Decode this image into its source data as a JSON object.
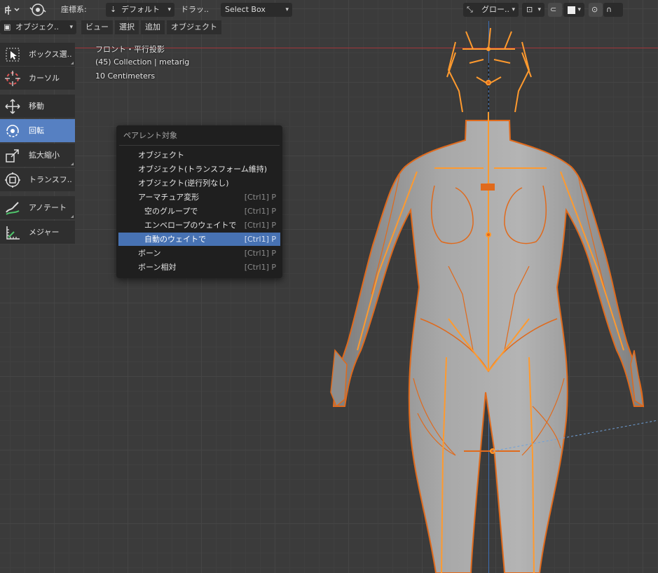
{
  "header": {
    "coord_label": "座標系:",
    "orientation_value": "デフォルト",
    "drag_label": "ドラッ..",
    "select_box": "Select Box",
    "transform_orient": "グロー..",
    "icons": [
      "transform-gizmo-icon",
      "pivot-icon",
      "orientation-axes-icon",
      "snap-icon",
      "proportional-icon",
      "falloff-icon",
      "overlay-icon",
      "shading-icon"
    ]
  },
  "row2": {
    "mode": "オブジェク..",
    "menus": [
      "ビュー",
      "選択",
      "追加",
      "オブジェクト"
    ]
  },
  "toolbar": {
    "items": [
      {
        "label": "ボックス選..",
        "icon": "select-box-icon",
        "active": false
      },
      {
        "label": "カーソル",
        "icon": "cursor-icon",
        "active": false
      },
      {
        "label": "移動",
        "icon": "move-icon",
        "active": false
      },
      {
        "label": "回転",
        "icon": "rotate-icon",
        "active": true
      },
      {
        "label": "拡大縮小",
        "icon": "scale-icon",
        "active": false
      },
      {
        "label": "トランスフ..",
        "icon": "transform-icon",
        "active": false
      },
      {
        "label": "アノテート",
        "icon": "annotate-icon",
        "active": false
      },
      {
        "label": "メジャー",
        "icon": "measure-icon",
        "active": false
      }
    ]
  },
  "overlay": {
    "view_name": "フロント・平行投影",
    "collection": "(45) Collection | metarig",
    "scale": "10 Centimeters"
  },
  "popup": {
    "title": "ペアレント対象",
    "items": [
      {
        "label": "オブジェクト",
        "shortcut": "",
        "sub": false,
        "selected": false
      },
      {
        "label": "オブジェクト(トランスフォーム維持)",
        "shortcut": "",
        "sub": false,
        "selected": false
      },
      {
        "label": "オブジェクト(逆行列なし)",
        "shortcut": "",
        "sub": false,
        "selected": false
      },
      {
        "label": "アーマチュア変形",
        "shortcut": "[Ctrl1] P",
        "sub": false,
        "selected": false
      },
      {
        "label": "空のグループで",
        "shortcut": "[Ctrl1] P",
        "sub": true,
        "selected": false
      },
      {
        "label": "エンベロープのウェイトで",
        "shortcut": "[Ctrl1] P",
        "sub": true,
        "selected": false
      },
      {
        "label": "自動のウェイトで",
        "shortcut": "[Ctrl1] P",
        "sub": true,
        "selected": true
      },
      {
        "label": "ボーン",
        "shortcut": "[Ctrl1] P",
        "sub": false,
        "selected": false
      },
      {
        "label": "ボーン相対",
        "shortcut": "[Ctrl1] P",
        "sub": false,
        "selected": false
      }
    ]
  },
  "colors": {
    "active_tool": "#5680c2",
    "selected_menu": "#4772b3",
    "outline": "#e06a1c",
    "bones": "#ff9a2e",
    "mesh": "#9a9a9a",
    "x_axis": "#a3353a",
    "z_axis": "#3c6eb2"
  }
}
